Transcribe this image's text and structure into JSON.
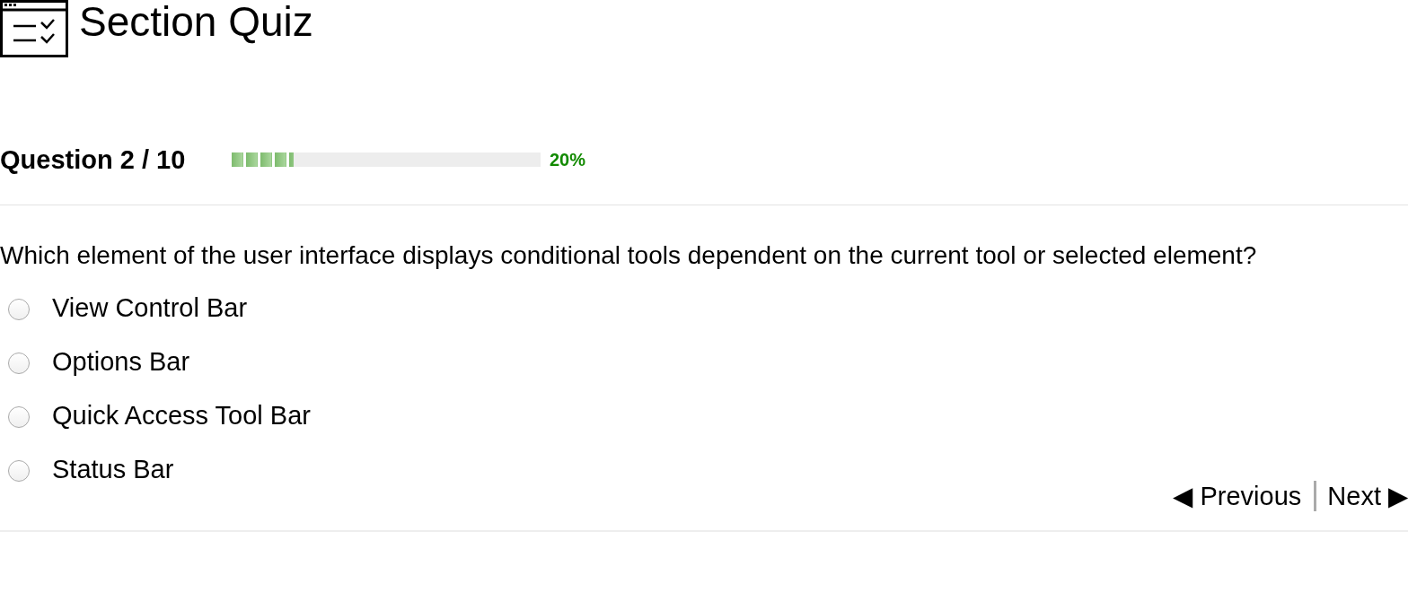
{
  "header": {
    "title": "Section Quiz"
  },
  "progress": {
    "label": "Question 2 / 10",
    "level": 0.2,
    "reading": "20%"
  },
  "question": {
    "text": "Which element of the user interface displays conditional tools dependent on the current tool or selected element?",
    "options": [
      {
        "label": "View Control Bar",
        "selected": false
      },
      {
        "label": "Options Bar",
        "selected": false
      },
      {
        "label": "Quick Access Tool Bar",
        "selected": false
      },
      {
        "label": "Status Bar",
        "selected": false
      }
    ]
  },
  "navigation": {
    "previous": "◀ Previous",
    "next": "Next ▶"
  }
}
